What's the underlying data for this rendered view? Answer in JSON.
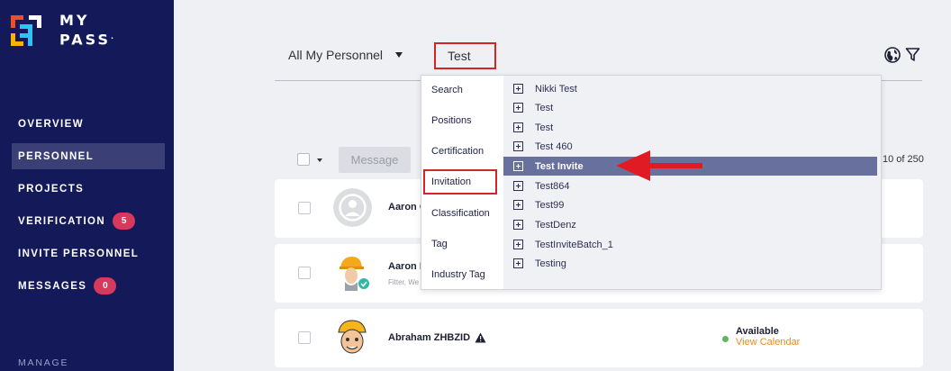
{
  "brand": {
    "line1": "MY",
    "line2": "PASS",
    "trademark": "."
  },
  "nav": [
    {
      "label": "OVERVIEW",
      "active": false
    },
    {
      "label": "PERSONNEL",
      "active": true
    },
    {
      "label": "PROJECTS",
      "active": false
    },
    {
      "label": "VERIFICATION",
      "badge": "5"
    },
    {
      "label": "INVITE PERSONNEL"
    },
    {
      "label": "MESSAGES",
      "badge": "0"
    }
  ],
  "manage_label": "MANAGE",
  "filter": {
    "selected": "All My Personnel"
  },
  "search": {
    "value": "Test"
  },
  "toolbar": {
    "message_label": "Message",
    "page_count": "10 of 250"
  },
  "dropdown": {
    "categories": [
      "Search",
      "Positions",
      "Certification",
      "Invitation",
      "Classification",
      "Tag",
      "Industry Tag"
    ],
    "highlighted_category": "Invitation",
    "results": [
      "Nikki Test",
      "Test",
      "Test",
      "Test 460",
      "Test Invite",
      "Test864",
      "Test99",
      "TestDenz",
      "TestInviteBatch_1",
      "Testing"
    ],
    "selected_result": "Test Invite"
  },
  "personnel": [
    {
      "name": "Aaron C",
      "subtitle": ""
    },
    {
      "name": "Aaron F",
      "subtitle": "Fitter, We"
    },
    {
      "name": "Abraham ZHBZID",
      "status": "Available",
      "status_link": "View Calendar",
      "warning": true
    }
  ],
  "colors": {
    "sidebar": "#14195a",
    "badge": "#d7395c",
    "highlight": "#d42424",
    "selected_row": "#68719e",
    "arrow": "#e01b24",
    "calendar_link": "#f08a17",
    "available_dot": "#5cb85c"
  }
}
